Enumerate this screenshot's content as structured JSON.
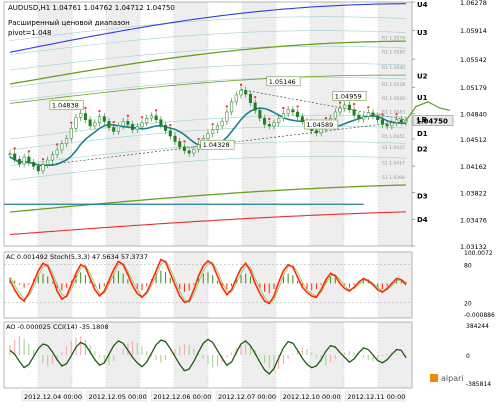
{
  "header": {
    "symbol_line": "AUDUSD,H1  1.04761 1.04762 1.04712 1.04750",
    "subtitle": "Расширенный ценовой диапазон",
    "pivot": "pivot=1.048"
  },
  "colors": {
    "candle_body": "#1f7f1f",
    "candle_bear": "#ff2222",
    "ma_teal": "#1f7f8f",
    "band_blue": "#2d3fe0",
    "band_green": "#6d9f1f",
    "band_red": "#e83030",
    "level_light": "#9ed0d0",
    "osc_red": "#ff2a00",
    "osc_green": "#3a7a1a",
    "price_tag": "#e9e9e9"
  },
  "logo_text": "alpari",
  "chart_data": [
    {
      "type": "line",
      "panel": "price",
      "title": "AUDUSD,H1",
      "y_ticks": [
        "1.06278",
        "1.05914",
        "1.05542",
        "1.05179",
        "1.04840",
        "1.04750",
        "1.04512",
        "1.04162",
        "1.03822",
        "1.03476",
        "1.03132"
      ],
      "current_price": "1.04750",
      "level_labels": [
        "U4",
        "U3",
        "U2",
        "U1",
        "LB",
        "D1",
        "D2",
        "D3",
        "D4"
      ],
      "minor_level_labels": [
        "R1 1.0578",
        "R1 1.0560",
        "R1 1.0540",
        "R1 1.0518",
        "R1 1.0500",
        "R1 1.0483",
        "R1 1.0451",
        "S1 1.0437",
        "S1 1.0417",
        "S1 1.0398"
      ],
      "annotations": [
        {
          "text": "1.04838",
          "x_index": 12,
          "price": 1.04838
        },
        {
          "text": "1.05146",
          "x_index": 58,
          "price": 1.05146
        },
        {
          "text": "1.04959",
          "x_index": 72,
          "price": 1.04959
        },
        {
          "text": "1.04328",
          "x_index": 44,
          "price": 1.04328
        },
        {
          "text": "1.04589",
          "x_index": 66,
          "price": 1.04589
        }
      ],
      "ylim": [
        1.03132,
        1.06278
      ],
      "close": [
        1.0432,
        1.0425,
        1.0419,
        1.0428,
        1.0421,
        1.0416,
        1.041,
        1.0418,
        1.0424,
        1.0431,
        1.0437,
        1.0445,
        1.0452,
        1.0465,
        1.0479,
        1.0484,
        1.0476,
        1.0468,
        1.0472,
        1.048,
        1.0474,
        1.0466,
        1.0461,
        1.0468,
        1.0474,
        1.047,
        1.0463,
        1.0467,
        1.0472,
        1.0478,
        1.0481,
        1.0476,
        1.0469,
        1.0462,
        1.0455,
        1.0448,
        1.0441,
        1.0436,
        1.0433,
        1.0438,
        1.0444,
        1.0452,
        1.0458,
        1.0463,
        1.0468,
        1.0474,
        1.0486,
        1.0499,
        1.0508,
        1.0514,
        1.0509,
        1.0498,
        1.0488,
        1.0478,
        1.047,
        1.0468,
        1.0472,
        1.0478,
        1.0484,
        1.0489,
        1.0486,
        1.048,
        1.0474,
        1.0468,
        1.0462,
        1.0459,
        1.0464,
        1.0471,
        1.0478,
        1.0486,
        1.0491,
        1.0495,
        1.0489,
        1.0482,
        1.0477,
        1.048,
        1.0485,
        1.0481,
        1.0476,
        1.047,
        1.0468,
        1.0472,
        1.0476,
        1.0473,
        1.0475
      ]
    },
    {
      "type": "line",
      "panel": "oscillator_1",
      "title": "AC 0.001492  Stoch(5,3,3) 47.5634 57.3737",
      "y_ticks": [
        "100.0072",
        "80",
        "20",
        "-0.000886"
      ],
      "ylim": [
        -5,
        100
      ],
      "stoch_main": [
        55,
        40,
        28,
        22,
        35,
        52,
        70,
        82,
        78,
        60,
        38,
        25,
        30,
        48,
        66,
        80,
        76,
        58,
        40,
        30,
        38,
        55,
        72,
        85,
        80,
        64,
        46,
        34,
        28,
        36,
        52,
        70,
        88,
        84,
        66,
        48,
        30,
        20,
        22,
        40,
        62,
        78,
        86,
        80,
        62,
        44,
        32,
        40,
        58,
        74,
        82,
        70,
        50,
        34,
        22,
        18,
        30,
        52,
        70,
        80,
        76,
        60,
        44,
        36,
        30,
        28,
        40,
        56,
        66,
        62,
        50,
        42,
        38,
        44,
        52,
        58,
        54,
        48,
        40,
        36,
        42,
        50,
        58,
        56,
        48
      ],
      "stoch_signal": [
        60,
        48,
        34,
        26,
        30,
        44,
        62,
        76,
        80,
        68,
        48,
        32,
        28,
        40,
        58,
        74,
        78,
        66,
        48,
        34,
        34,
        48,
        64,
        80,
        82,
        70,
        54,
        40,
        30,
        32,
        46,
        62,
        80,
        86,
        74,
        56,
        38,
        24,
        20,
        32,
        52,
        70,
        82,
        84,
        70,
        52,
        38,
        36,
        50,
        66,
        78,
        76,
        58,
        42,
        28,
        20,
        24,
        42,
        62,
        76,
        78,
        68,
        52,
        40,
        34,
        30,
        36,
        50,
        62,
        64,
        56,
        46,
        40,
        42,
        48,
        54,
        56,
        50,
        44,
        38,
        40,
        46,
        54,
        56,
        52
      ],
      "ac_histogram": [
        0.4,
        0.2,
        -0.1,
        -0.3,
        -0.1,
        0.3,
        0.6,
        0.7,
        0.5,
        0.1,
        -0.3,
        -0.5,
        -0.3,
        0.2,
        0.6,
        0.8,
        0.6,
        0.2,
        -0.2,
        -0.4,
        -0.2,
        0.3,
        0.7,
        0.9,
        0.7,
        0.3,
        -0.1,
        -0.4,
        -0.5,
        -0.2,
        0.3,
        0.7,
        0.9,
        0.8,
        0.4,
        0.0,
        -0.4,
        -0.6,
        -0.5,
        -0.1,
        0.4,
        0.7,
        0.8,
        0.6,
        0.2,
        -0.2,
        -0.4,
        -0.2,
        0.3,
        0.6,
        0.7,
        0.5,
        0.1,
        -0.3,
        -0.6,
        -0.7,
        -0.4,
        0.1,
        0.5,
        0.7,
        0.6,
        0.2,
        -0.2,
        -0.4,
        -0.5,
        -0.4,
        -0.1,
        0.3,
        0.5,
        0.4,
        0.1,
        -0.1,
        -0.3,
        -0.1,
        0.2,
        0.4,
        0.3,
        0.0,
        -0.3,
        -0.4,
        -0.2,
        0.1,
        0.3,
        0.3,
        0.1
      ]
    },
    {
      "type": "line",
      "panel": "oscillator_2",
      "title": "AO -0.000025  CCI(14) -35.1808",
      "y_ticks": [
        "384244",
        "0",
        "-385814"
      ],
      "ylim": [
        -420,
        420
      ],
      "cci": [
        60,
        10,
        -80,
        -160,
        -120,
        -20,
        80,
        140,
        120,
        40,
        -60,
        -140,
        -110,
        -10,
        100,
        160,
        130,
        40,
        -60,
        -130,
        -100,
        10,
        120,
        180,
        150,
        60,
        -30,
        -100,
        -150,
        -90,
        20,
        130,
        190,
        170,
        80,
        -20,
        -120,
        -200,
        -180,
        -80,
        40,
        150,
        200,
        160,
        60,
        -40,
        -130,
        -90,
        30,
        140,
        180,
        120,
        20,
        -90,
        -190,
        -240,
        -170,
        -40,
        90,
        170,
        150,
        60,
        -40,
        -120,
        -160,
        -140,
        -60,
        50,
        120,
        100,
        30,
        -30,
        -90,
        -50,
        30,
        90,
        70,
        0,
        -70,
        -100,
        -60,
        10,
        70,
        60,
        -35
      ],
      "ao_histogram": [
        80,
        120,
        150,
        130,
        90,
        40,
        -10,
        -60,
        -90,
        -70,
        -30,
        20,
        70,
        110,
        140,
        150,
        120,
        80,
        30,
        -20,
        -60,
        -80,
        -50,
        0,
        50,
        90,
        110,
        100,
        70,
        30,
        -10,
        -40,
        -60,
        -40,
        0,
        40,
        70,
        90,
        80,
        50,
        10,
        -30,
        -70,
        -100,
        -90,
        -60,
        -20,
        20,
        60,
        90,
        100,
        80,
        40,
        -10,
        -60,
        -100,
        -130,
        -110,
        -70,
        -30,
        10,
        40,
        60,
        50,
        20,
        -20,
        -60,
        -80,
        -60,
        -30,
        0,
        20,
        30,
        20,
        0,
        -20,
        -40,
        -50,
        -30,
        -10,
        10,
        20,
        10,
        -5,
        -10
      ]
    },
    {
      "type": "table",
      "panel": "time_axis",
      "x_tick_labels": [
        "2012.12.04 00:00",
        "2012.12.05 00:00",
        "2012.12.06 00:00",
        "2012.12.07 00:00",
        "2012.12.10 00:00",
        "2012.12.11 00:00"
      ]
    }
  ]
}
